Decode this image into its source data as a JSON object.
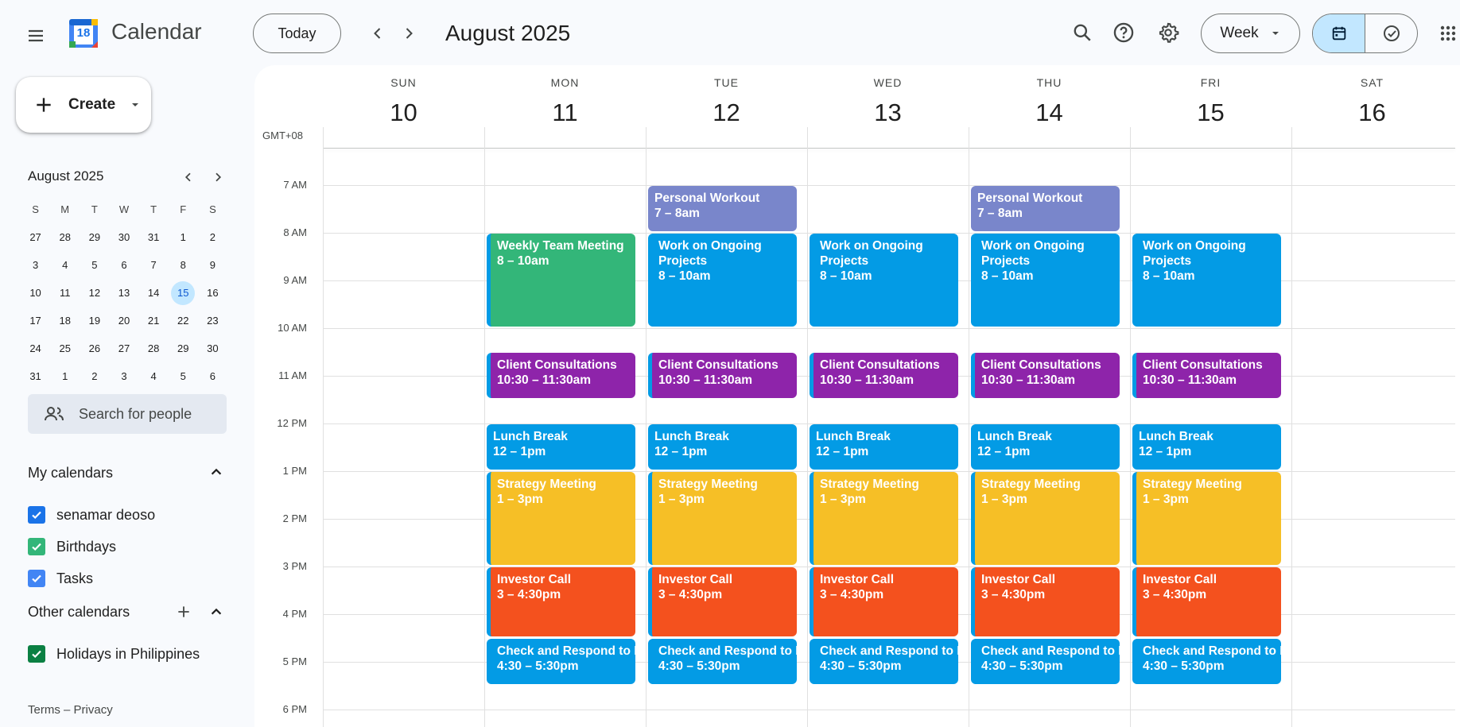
{
  "app": {
    "name": "Calendar",
    "logo_day": "18"
  },
  "header": {
    "today_label": "Today",
    "current_period": "August 2025",
    "view_select": "Week"
  },
  "sidebar": {
    "create_label": "Create",
    "mini_calendar": {
      "title": "August 2025",
      "dow": [
        "S",
        "M",
        "T",
        "W",
        "T",
        "F",
        "S"
      ],
      "weeks": [
        [
          "27",
          "28",
          "29",
          "30",
          "31",
          "1",
          "2"
        ],
        [
          "3",
          "4",
          "5",
          "6",
          "7",
          "8",
          "9"
        ],
        [
          "10",
          "11",
          "12",
          "13",
          "14",
          "15",
          "16"
        ],
        [
          "17",
          "18",
          "19",
          "20",
          "21",
          "22",
          "23"
        ],
        [
          "24",
          "25",
          "26",
          "27",
          "28",
          "29",
          "30"
        ],
        [
          "31",
          "1",
          "2",
          "3",
          "4",
          "5",
          "6"
        ]
      ],
      "selected": "15"
    },
    "search_people_placeholder": "Search for people",
    "my_calendars_title": "My calendars",
    "my_calendars": [
      {
        "label": "senamar deoso",
        "color": "#1a73e8"
      },
      {
        "label": "Birthdays",
        "color": "#33b679"
      },
      {
        "label": "Tasks",
        "color": "#4285f4"
      }
    ],
    "other_calendars_title": "Other calendars",
    "other_calendars": [
      {
        "label": "Holidays in Philippines",
        "color": "#0b8043"
      }
    ],
    "footer": {
      "terms": "Terms",
      "sep": "–",
      "privacy": "Privacy"
    }
  },
  "week": {
    "timezone": "GMT+08",
    "days": [
      {
        "dow": "SUN",
        "num": "10"
      },
      {
        "dow": "MON",
        "num": "11"
      },
      {
        "dow": "TUE",
        "num": "12"
      },
      {
        "dow": "WED",
        "num": "13"
      },
      {
        "dow": "THU",
        "num": "14"
      },
      {
        "dow": "FRI",
        "num": "15"
      },
      {
        "dow": "SAT",
        "num": "16"
      }
    ],
    "hours": [
      "7 AM",
      "8 AM",
      "9 AM",
      "10 AM",
      "11 AM",
      "12 PM",
      "1 PM",
      "2 PM",
      "3 PM",
      "4 PM",
      "5 PM",
      "6 PM"
    ]
  },
  "event_colors": {
    "workout": "#7986cb",
    "team": "#33b679",
    "projects": "#039be5",
    "consult": "#8e24aa",
    "lunch": "#039be5",
    "strategy": "#f6bf26",
    "investor": "#f4511e",
    "email": "#039be5"
  },
  "events": [
    {
      "day": 2,
      "start": 7,
      "end": 8,
      "title": "Personal Workout",
      "time": "7 – 8am",
      "kind": "workout"
    },
    {
      "day": 4,
      "start": 7,
      "end": 8,
      "title": "Personal Workout",
      "time": "7 – 8am",
      "kind": "workout"
    },
    {
      "day": 1,
      "start": 8,
      "end": 10,
      "title": "Weekly Team Meeting",
      "time": "8 – 10am",
      "kind": "team"
    },
    {
      "day": 2,
      "start": 8,
      "end": 10,
      "title": "Work on Ongoing Projects",
      "time": "8 – 10am",
      "kind": "projects"
    },
    {
      "day": 3,
      "start": 8,
      "end": 10,
      "title": "Work on Ongoing Projects",
      "time": "8 – 10am",
      "kind": "projects"
    },
    {
      "day": 4,
      "start": 8,
      "end": 10,
      "title": "Work on Ongoing Projects",
      "time": "8 – 10am",
      "kind": "projects"
    },
    {
      "day": 5,
      "start": 8,
      "end": 10,
      "title": "Work on Ongoing Projects",
      "time": "8 – 10am",
      "kind": "projects"
    },
    {
      "day": 1,
      "start": 10.5,
      "end": 11.5,
      "title": "Client Consultations",
      "time": "10:30 – 11:30am",
      "kind": "consult"
    },
    {
      "day": 2,
      "start": 10.5,
      "end": 11.5,
      "title": "Client Consultations",
      "time": "10:30 – 11:30am",
      "kind": "consult"
    },
    {
      "day": 3,
      "start": 10.5,
      "end": 11.5,
      "title": "Client Consultations",
      "time": "10:30 – 11:30am",
      "kind": "consult"
    },
    {
      "day": 4,
      "start": 10.5,
      "end": 11.5,
      "title": "Client Consultations",
      "time": "10:30 – 11:30am",
      "kind": "consult"
    },
    {
      "day": 5,
      "start": 10.5,
      "end": 11.5,
      "title": "Client Consultations",
      "time": "10:30 – 11:30am",
      "kind": "consult"
    },
    {
      "day": 1,
      "start": 12,
      "end": 13,
      "title": "Lunch Break",
      "time": "12 – 1pm",
      "kind": "lunch"
    },
    {
      "day": 2,
      "start": 12,
      "end": 13,
      "title": "Lunch Break",
      "time": "12 – 1pm",
      "kind": "lunch"
    },
    {
      "day": 3,
      "start": 12,
      "end": 13,
      "title": "Lunch Break",
      "time": "12 – 1pm",
      "kind": "lunch"
    },
    {
      "day": 4,
      "start": 12,
      "end": 13,
      "title": "Lunch Break",
      "time": "12 – 1pm",
      "kind": "lunch"
    },
    {
      "day": 5,
      "start": 12,
      "end": 13,
      "title": "Lunch Break",
      "time": "12 – 1pm",
      "kind": "lunch"
    },
    {
      "day": 1,
      "start": 13,
      "end": 15,
      "title": "Strategy Meeting",
      "time": "1 – 3pm",
      "kind": "strategy"
    },
    {
      "day": 2,
      "start": 13,
      "end": 15,
      "title": "Strategy Meeting",
      "time": "1 – 3pm",
      "kind": "strategy"
    },
    {
      "day": 3,
      "start": 13,
      "end": 15,
      "title": "Strategy Meeting",
      "time": "1 – 3pm",
      "kind": "strategy"
    },
    {
      "day": 4,
      "start": 13,
      "end": 15,
      "title": "Strategy Meeting",
      "time": "1 – 3pm",
      "kind": "strategy"
    },
    {
      "day": 5,
      "start": 13,
      "end": 15,
      "title": "Strategy Meeting",
      "time": "1 – 3pm",
      "kind": "strategy"
    },
    {
      "day": 1,
      "start": 15,
      "end": 16.5,
      "title": "Investor Call",
      "time": "3 – 4:30pm",
      "kind": "investor"
    },
    {
      "day": 2,
      "start": 15,
      "end": 16.5,
      "title": "Investor Call",
      "time": "3 – 4:30pm",
      "kind": "investor"
    },
    {
      "day": 3,
      "start": 15,
      "end": 16.5,
      "title": "Investor Call",
      "time": "3 – 4:30pm",
      "kind": "investor"
    },
    {
      "day": 4,
      "start": 15,
      "end": 16.5,
      "title": "Investor Call",
      "time": "3 – 4:30pm",
      "kind": "investor"
    },
    {
      "day": 5,
      "start": 15,
      "end": 16.5,
      "title": "Investor Call",
      "time": "3 – 4:30pm",
      "kind": "investor"
    },
    {
      "day": 1,
      "start": 16.5,
      "end": 17.5,
      "title": "Check and Respond to Emails",
      "time": "4:30 – 5:30pm",
      "kind": "email"
    },
    {
      "day": 2,
      "start": 16.5,
      "end": 17.5,
      "title": "Check and Respond to Emails",
      "time": "4:30 – 5:30pm",
      "kind": "email"
    },
    {
      "day": 3,
      "start": 16.5,
      "end": 17.5,
      "title": "Check and Respond to Emails",
      "time": "4:30 – 5:30pm",
      "kind": "email"
    },
    {
      "day": 4,
      "start": 16.5,
      "end": 17.5,
      "title": "Check and Respond to Emails",
      "time": "4:30 – 5:30pm",
      "kind": "email"
    },
    {
      "day": 5,
      "start": 16.5,
      "end": 17.5,
      "title": "Check and Respond to Emails",
      "time": "4:30 – 5:30pm",
      "kind": "email"
    }
  ]
}
